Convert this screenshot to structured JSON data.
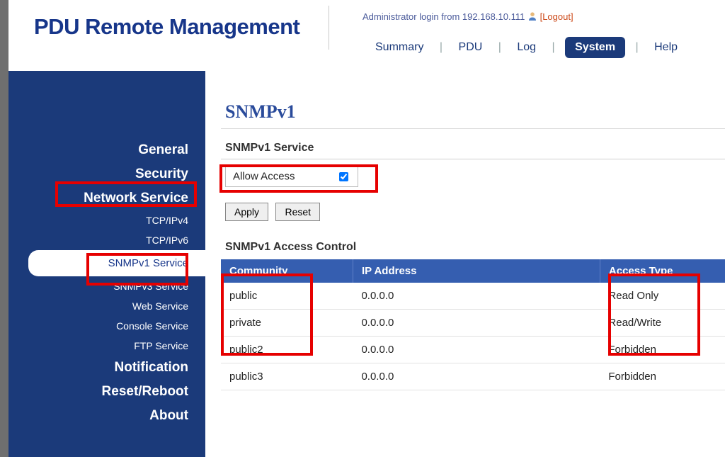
{
  "header": {
    "logo": "PDU Remote Management",
    "login_prefix": "Administrator login from ",
    "login_ip": "192.168.10.111",
    "logout": "[Logout]",
    "nav": {
      "summary": "Summary",
      "pdu": "PDU",
      "log": "Log",
      "system": "System",
      "help": "Help"
    }
  },
  "sidebar": {
    "general": "General",
    "security": "Security",
    "network_service": "Network Service",
    "tcpipv4": "TCP/IPv4",
    "tcpipv6": "TCP/IPv6",
    "snmpv1_service": "SNMPv1 Service",
    "snmpv3_service": "SNMPv3 Service",
    "web_service": "Web Service",
    "console_service": "Console Service",
    "ftp_service": "FTP Service",
    "notification": "Notification",
    "reset_reboot": "Reset/Reboot",
    "about": "About"
  },
  "page": {
    "title": "SNMPv1",
    "service_section": "SNMPv1 Service",
    "allow_access_label": "Allow Access",
    "apply": "Apply",
    "reset": "Reset",
    "access_section": "SNMPv1 Access Control",
    "table": {
      "headers": {
        "community": "Community",
        "ip": "IP Address",
        "access": "Access Type"
      },
      "rows": [
        {
          "community": "public",
          "ip": "0.0.0.0",
          "access": "Read Only"
        },
        {
          "community": "private",
          "ip": "0.0.0.0",
          "access": "Read/Write"
        },
        {
          "community": "public2",
          "ip": "0.0.0.0",
          "access": "Forbidden"
        },
        {
          "community": "public3",
          "ip": "0.0.0.0",
          "access": "Forbidden"
        }
      ]
    }
  }
}
